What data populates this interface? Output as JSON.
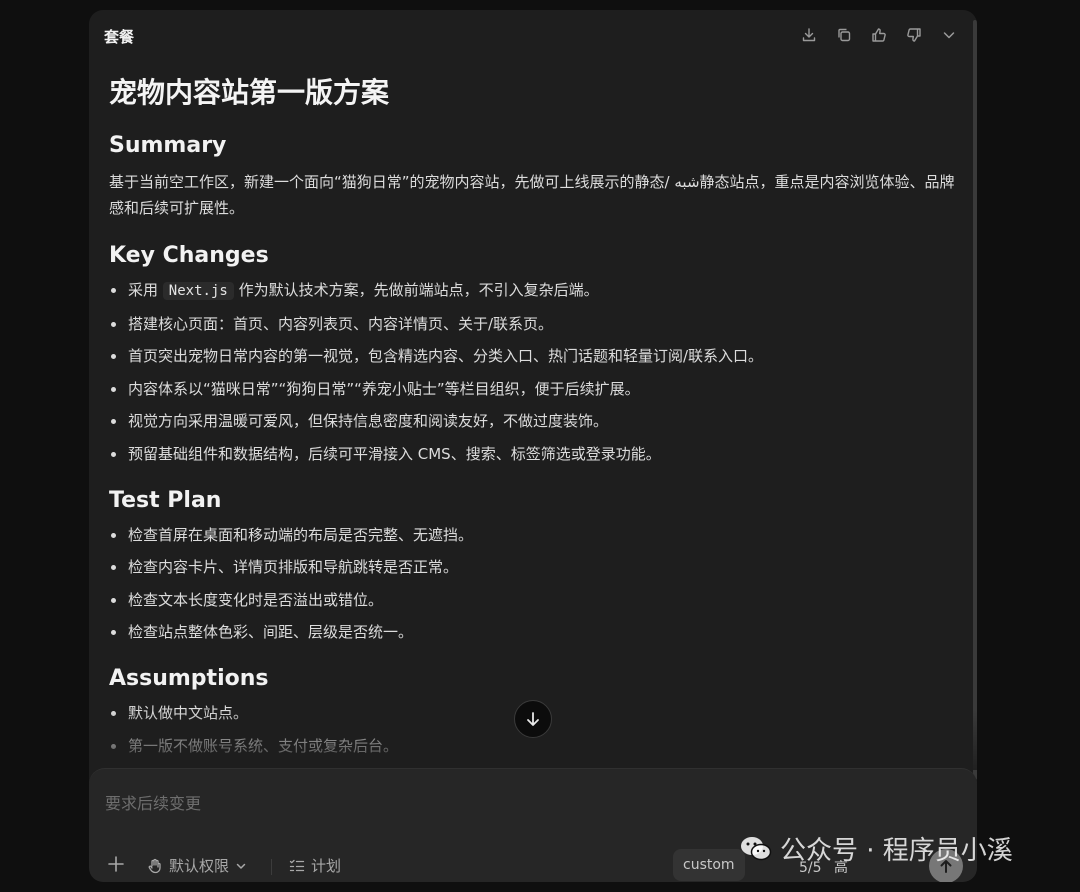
{
  "header": {
    "title": "套餐",
    "actions": [
      "download-icon",
      "copy-icon",
      "thumbs-up-icon",
      "thumbs-down-icon",
      "chevron-down-icon"
    ]
  },
  "doc": {
    "title": "宠物内容站第一版方案",
    "summary": {
      "heading": "Summary",
      "text": "基于当前空工作区，新建一个面向“猫狗日常”的宠物内容站，先做可上线展示的静态/ شبه静态站点，重点是内容浏览体验、品牌感和后续可扩展性。"
    },
    "key_changes": {
      "heading": "Key Changes",
      "item0_pre": "采用",
      "item0_code": "Next.js",
      "item0_post": "作为默认技术方案，先做前端站点，不引入复杂后端。",
      "items": [
        "搭建核心页面：首页、内容列表页、内容详情页、关于/联系页。",
        "首页突出宠物日常内容的第一视觉，包含精选内容、分类入口、热门话题和轻量订阅/联系入口。",
        "内容体系以“猫咪日常”“狗狗日常”“养宠小贴士”等栏目组织，便于后续扩展。",
        "视觉方向采用温暖可爱风，但保持信息密度和阅读友好，不做过度装饰。",
        "预留基础组件和数据结构，后续可平滑接入 CMS、搜索、标签筛选或登录功能。"
      ]
    },
    "test_plan": {
      "heading": "Test Plan",
      "items": [
        "检查首屏在桌面和移动端的布局是否完整、无遮挡。",
        "检查内容卡片、详情页排版和导航跳转是否正常。",
        "检查文本长度变化时是否溢出或错位。",
        "检查站点整体色彩、间距、层级是否统一。"
      ]
    },
    "assumptions": {
      "heading": "Assumptions",
      "items": [
        "默认做中文站点。",
        "第一版不做账号系统、支付或复杂后台。"
      ]
    }
  },
  "composer": {
    "placeholder": "要求后续变更",
    "permissions_label": "默认权限",
    "plan_label": "计划",
    "model_label": "custom",
    "counter": "5/5",
    "level_label": "高"
  },
  "watermark": {
    "text": "公众号 · 程序员小溪"
  }
}
